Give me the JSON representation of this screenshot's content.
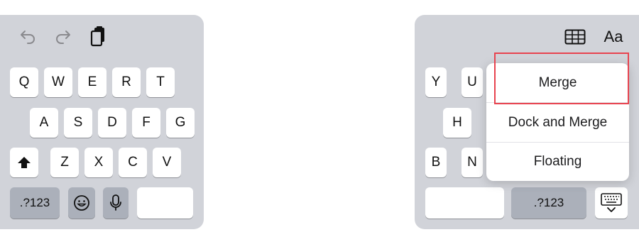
{
  "left_keyboard": {
    "toolbar": {
      "undo_icon": "undo-arrow-icon",
      "redo_icon": "redo-arrow-icon",
      "paste_icon": "clipboard-paste-icon"
    },
    "row1": [
      "Q",
      "W",
      "E",
      "R",
      "T"
    ],
    "row2": [
      "A",
      "S",
      "D",
      "F",
      "G"
    ],
    "row3": [
      "Z",
      "X",
      "C",
      "V"
    ],
    "shift_icon": "shift-arrow-icon",
    "numbers_label": ".?123",
    "emoji_icon": "emoji-icon",
    "mic_icon": "microphone-icon"
  },
  "right_keyboard": {
    "toolbar": {
      "table_icon": "table-icon",
      "format_label": "Aa"
    },
    "keys": [
      "Y",
      "U",
      "H",
      "B",
      "N"
    ],
    "numbers_label": ".?123",
    "keyboard_icon": "keyboard-dismiss-icon"
  },
  "menu": {
    "items": [
      "Merge",
      "Dock and Merge",
      "Floating"
    ],
    "highlight_color": "#e8434f"
  },
  "colors": {
    "keyboard_bg": "#d1d3d9",
    "key_bg": "#ffffff",
    "dark_key_bg": "#abb0ba"
  }
}
